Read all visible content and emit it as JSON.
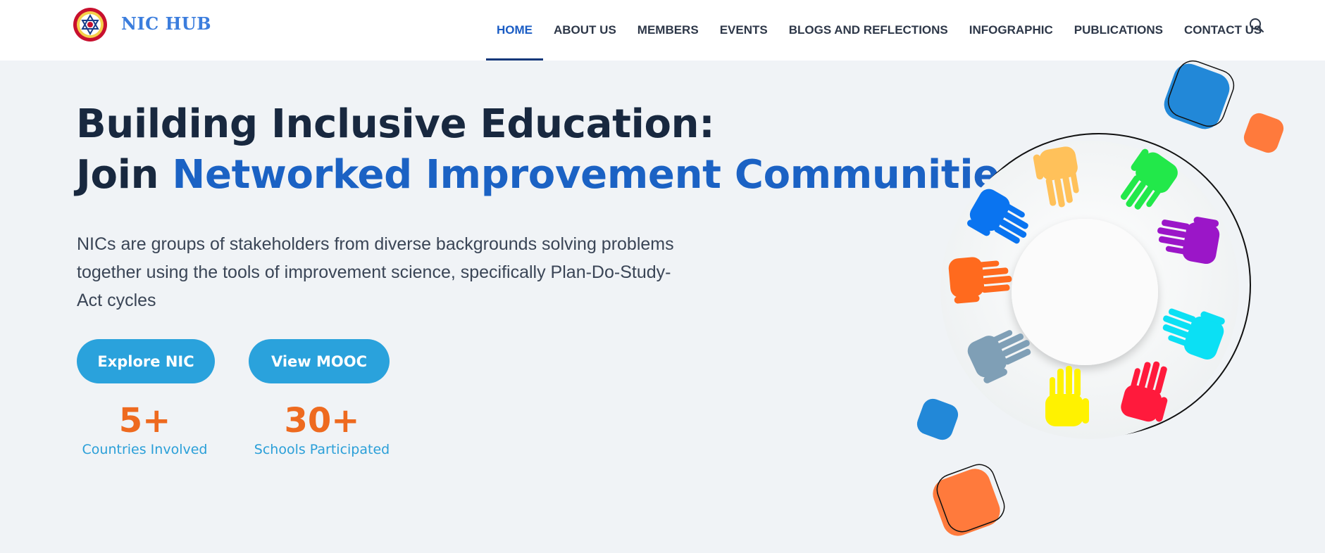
{
  "header": {
    "brand": "NIC HUB",
    "nav": [
      {
        "label": "HOME",
        "active": true
      },
      {
        "label": "ABOUT US"
      },
      {
        "label": "MEMBERS"
      },
      {
        "label": "EVENTS"
      },
      {
        "label": "BLOGS AND REFLECTIONS"
      },
      {
        "label": "INFOGRAPHIC"
      },
      {
        "label": "PUBLICATIONS"
      },
      {
        "label": "CONTACT US"
      }
    ],
    "search_icon": "search-icon"
  },
  "hero": {
    "title_line1": "Building Inclusive Education:",
    "title_line2_prefix": "Join ",
    "title_line2_accent": "Networked Improvement Communities",
    "description": "NICs are groups of stakeholders from diverse backgrounds solving problems together using the tools of improvement science, specifically Plan-Do-Study-Act cycles",
    "buttons": {
      "explore": "Explore NIC",
      "mooc": "View MOOC"
    },
    "stats": [
      {
        "value": "5+",
        "label": "Countries Involved"
      },
      {
        "value": "30+",
        "label": "Schools Participated"
      }
    ]
  },
  "colors": {
    "accent_blue": "#1b62c4",
    "button_blue": "#2aa2dc",
    "stat_orange": "#ee6a1f",
    "heading_dark": "#18283f"
  }
}
